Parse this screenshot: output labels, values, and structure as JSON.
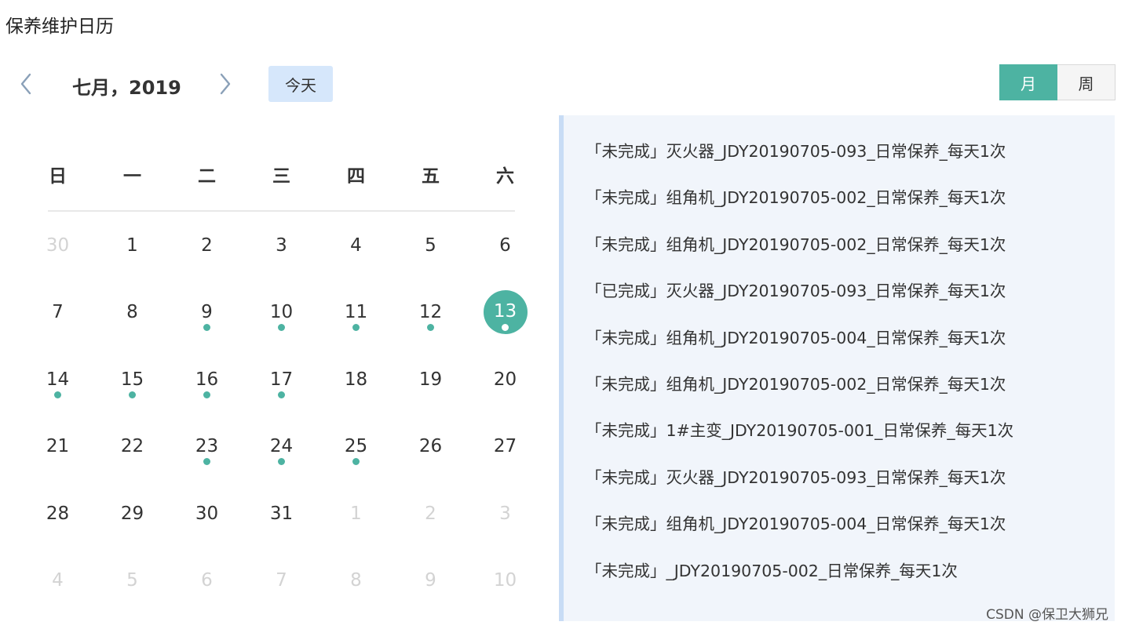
{
  "page": {
    "title": "保养维护日历"
  },
  "header": {
    "month_label": "七月，2019",
    "today_label": "今天",
    "view_month": "月",
    "view_week": "周"
  },
  "weekdays": [
    "日",
    "一",
    "二",
    "三",
    "四",
    "五",
    "六"
  ],
  "weeks": [
    [
      {
        "d": "30",
        "muted": true
      },
      {
        "d": "1"
      },
      {
        "d": "2"
      },
      {
        "d": "3"
      },
      {
        "d": "4"
      },
      {
        "d": "5"
      },
      {
        "d": "6"
      }
    ],
    [
      {
        "d": "7"
      },
      {
        "d": "8"
      },
      {
        "d": "9",
        "dot": true
      },
      {
        "d": "10",
        "dot": true
      },
      {
        "d": "11",
        "dot": true
      },
      {
        "d": "12",
        "dot": true
      },
      {
        "d": "13",
        "dot": true,
        "selected": true
      }
    ],
    [
      {
        "d": "14",
        "dot": true
      },
      {
        "d": "15",
        "dot": true
      },
      {
        "d": "16",
        "dot": true
      },
      {
        "d": "17",
        "dot": true
      },
      {
        "d": "18"
      },
      {
        "d": "19"
      },
      {
        "d": "20"
      }
    ],
    [
      {
        "d": "21"
      },
      {
        "d": "22"
      },
      {
        "d": "23",
        "dot": true
      },
      {
        "d": "24",
        "dot": true
      },
      {
        "d": "25",
        "dot": true
      },
      {
        "d": "26"
      },
      {
        "d": "27"
      }
    ],
    [
      {
        "d": "28"
      },
      {
        "d": "29"
      },
      {
        "d": "30"
      },
      {
        "d": "31"
      },
      {
        "d": "1",
        "muted": true
      },
      {
        "d": "2",
        "muted": true
      },
      {
        "d": "3",
        "muted": true
      }
    ],
    [
      {
        "d": "4",
        "muted": true
      },
      {
        "d": "5",
        "muted": true
      },
      {
        "d": "6",
        "muted": true
      },
      {
        "d": "7",
        "muted": true
      },
      {
        "d": "8",
        "muted": true
      },
      {
        "d": "9",
        "muted": true
      },
      {
        "d": "10",
        "muted": true
      }
    ]
  ],
  "events": [
    "「未完成」灭火器_JDY20190705-093_日常保养_每天1次",
    "「未完成」组角机_JDY20190705-002_日常保养_每天1次",
    "「未完成」组角机_JDY20190705-002_日常保养_每天1次",
    "「已完成」灭火器_JDY20190705-093_日常保养_每天1次",
    "「未完成」组角机_JDY20190705-004_日常保养_每天1次",
    "「未完成」组角机_JDY20190705-002_日常保养_每天1次",
    "「未完成」1#主变_JDY20190705-001_日常保养_每天1次",
    "「未完成」灭火器_JDY20190705-093_日常保养_每天1次",
    "「未完成」组角机_JDY20190705-004_日常保养_每天1次",
    "「未完成」_JDY20190705-002_日常保养_每天1次"
  ],
  "watermark": "CSDN @保卫大狮兄",
  "colors": {
    "accent": "#4db3a2",
    "today_bg": "#d6e7fb",
    "panel_bg": "#f1f5fb",
    "panel_border": "#c8dcf5"
  },
  "icons": {
    "prev": "chevron-left-icon",
    "next": "chevron-right-icon"
  }
}
